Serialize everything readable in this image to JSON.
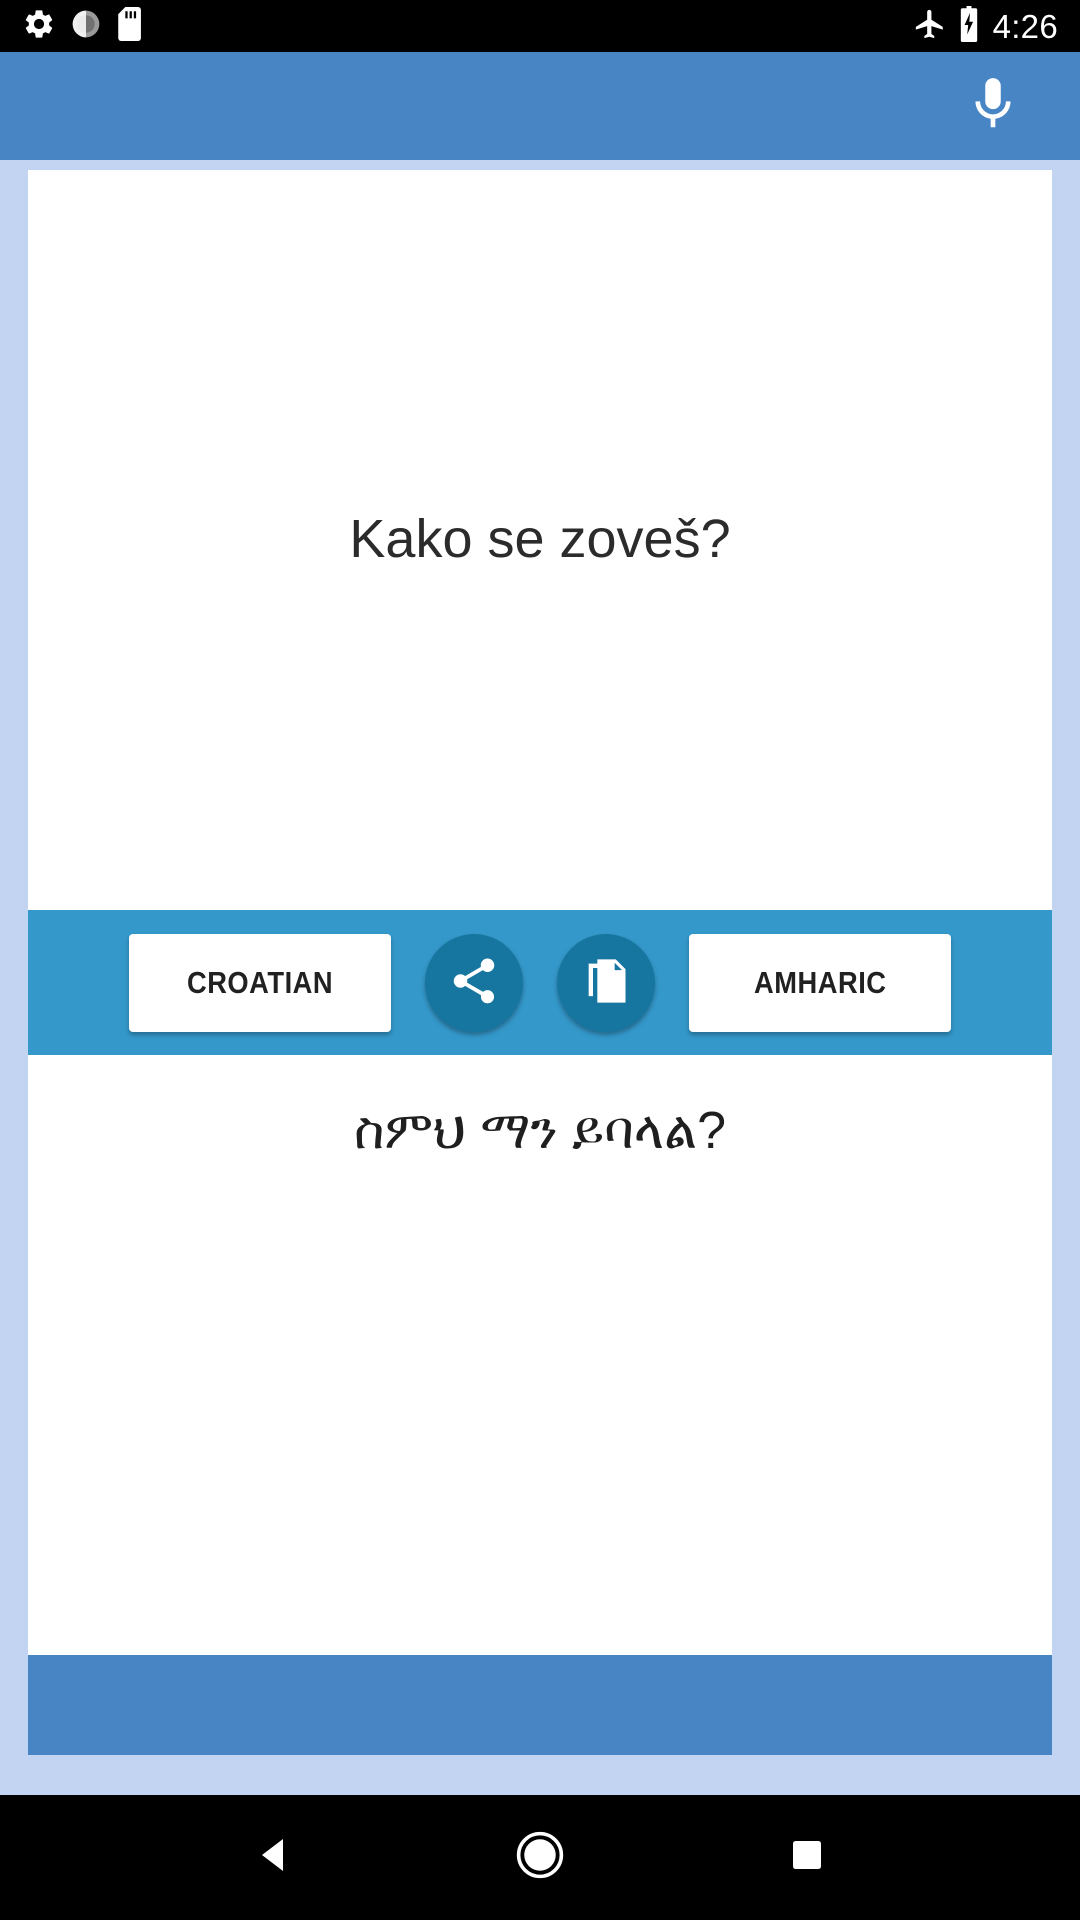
{
  "status_bar": {
    "icons_left": [
      "settings-gear-icon",
      "compass-icon",
      "sd-card-icon"
    ],
    "icons_right": [
      "airplane-mode-icon",
      "battery-charging-icon"
    ],
    "clock": "4:26"
  },
  "app_bar": {
    "mic_icon": "microphone-icon",
    "title": ""
  },
  "translator": {
    "source_text": "Kako se zoveš?",
    "target_text": "ስምህ ማን ይባላል?",
    "source_language": "CROATIAN",
    "target_language": "AMHARIC",
    "share_icon": "share-icon",
    "copy_icon": "copy-icon"
  },
  "nav_bar": {
    "back": "back-triangle-icon",
    "home": "home-circle-icon",
    "recents": "recents-square-icon"
  },
  "colors": {
    "app_bar": "#4885c4",
    "page_background": "#c3d4f2",
    "toolbar": "#3498ca",
    "circle_button": "#17769f",
    "card": "#ffffff"
  }
}
